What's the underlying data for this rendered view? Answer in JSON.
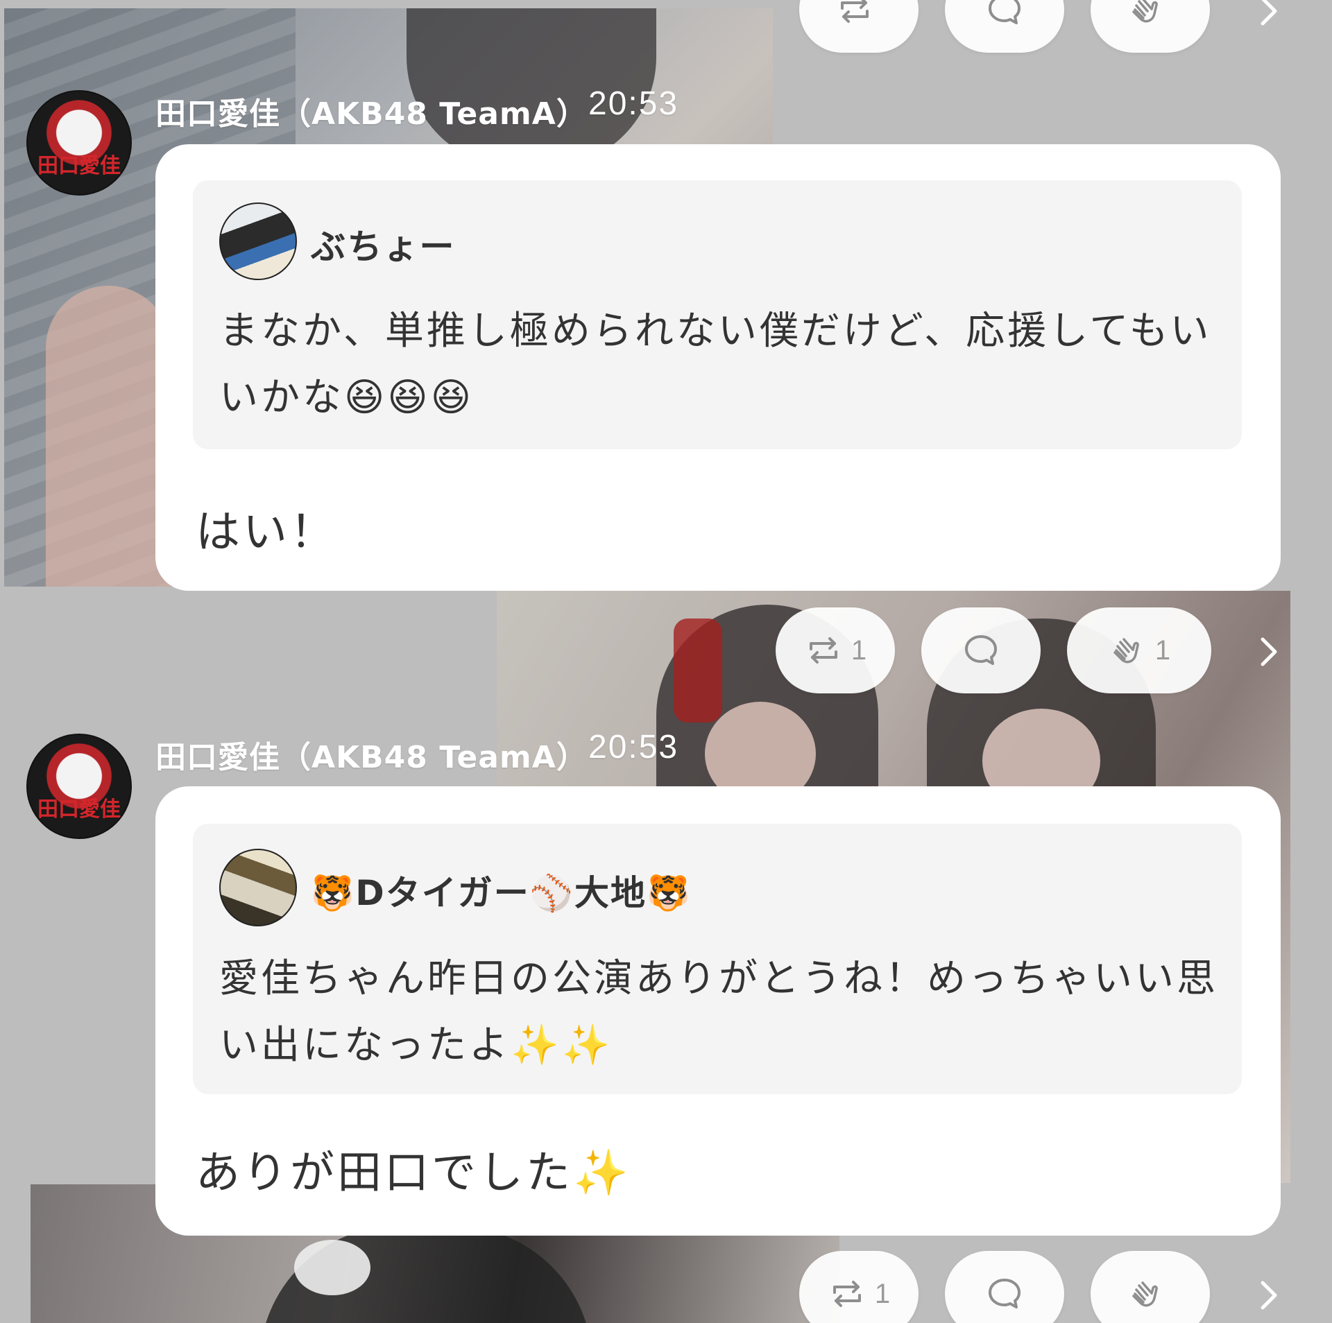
{
  "posts": [
    {
      "author": "田口愛佳（AKB48 TeamA）",
      "time": "20:53",
      "avatar_text": "田口愛佳",
      "quote": {
        "name": "ぶちょー",
        "text": "まなか、単推し極められない僕だけど、応援してもいいかな😆😆😆"
      },
      "reply": "はい！"
    },
    {
      "author": "田口愛佳（AKB48 TeamA）",
      "time": "20:53",
      "avatar_text": "田口愛佳",
      "quote": {
        "name": "🐯Dタイガー⚾大地🐯",
        "text": "愛佳ちゃん昨日の公演ありがとうね！めっちゃいい思い出になったよ✨✨"
      },
      "reply": "ありが田口でした✨"
    }
  ],
  "action_rows": [
    {
      "repost_count": "",
      "comment_count": "",
      "clap_count": ""
    },
    {
      "repost_count": "1",
      "comment_count": "",
      "clap_count": "1"
    },
    {
      "repost_count": "1",
      "comment_count": "",
      "clap_count": ""
    }
  ],
  "icons": {
    "repost": "repost-icon",
    "comment": "comment-bubble-icon",
    "clap": "clap-icon",
    "more": "chevron-right-icon"
  },
  "colors": {
    "background": "#bdbdbd",
    "bubble": "#ffffff",
    "quote_bg": "#f4f4f4",
    "icon_grey": "#8e8e8e"
  }
}
